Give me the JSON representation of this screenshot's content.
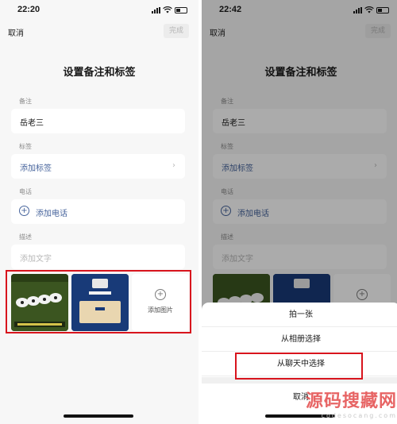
{
  "left": {
    "time": "22:20",
    "cancel": "取消",
    "done": "完成",
    "title": "设置备注和标签",
    "remark_label": "备注",
    "remark_value": "岳老三",
    "tags_label": "标签",
    "tags_link": "添加标签",
    "phone_label": "电话",
    "phone_link": "添加电话",
    "desc_label": "描述",
    "desc_placeholder": "添加文字",
    "add_photo": "添加图片"
  },
  "right": {
    "time": "22:42",
    "cancel": "取消",
    "done": "完成",
    "title": "设置备注和标签",
    "remark_label": "备注",
    "remark_value": "岳老三",
    "tags_label": "标签",
    "tags_link": "添加标签",
    "phone_label": "电话",
    "phone_link": "添加电话",
    "desc_label": "描述",
    "desc_placeholder": "添加文字",
    "sheet": {
      "option1": "拍一张",
      "option2": "从相册选择",
      "option3": "从聊天中选择",
      "cancel": "取消"
    }
  },
  "watermark": {
    "big": "源码搜藏网",
    "small": "codesocang.com"
  }
}
